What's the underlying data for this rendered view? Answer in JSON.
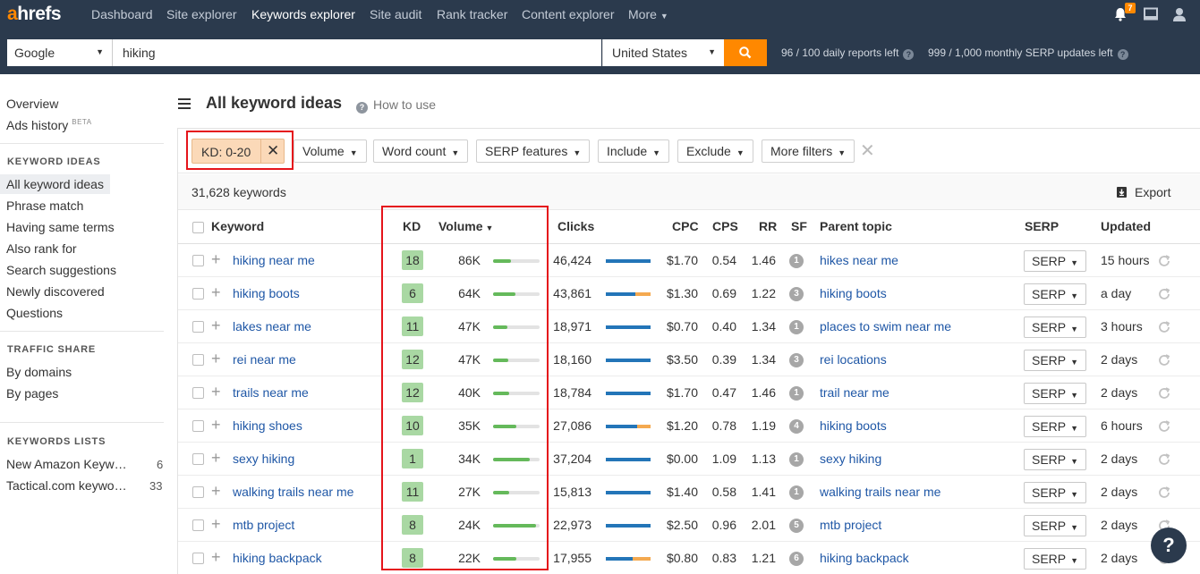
{
  "nav": {
    "logo_a": "a",
    "logo_rest": "hrefs",
    "items": [
      "Dashboard",
      "Site explorer",
      "Keywords explorer",
      "Site audit",
      "Rank tracker",
      "Content explorer",
      "More"
    ],
    "notifications_badge": "7"
  },
  "search": {
    "engine": "Google",
    "keyword": "hiking",
    "country": "United States",
    "daily_reports": "96 / 100 daily reports left",
    "monthly_updates": "999 / 1,000 monthly SERP updates left"
  },
  "sidebar": {
    "overview": "Overview",
    "ads_history": "Ads history",
    "beta": "BETA",
    "keyword_ideas_head": "KEYWORD IDEAS",
    "keyword_ideas": [
      "All keyword ideas",
      "Phrase match",
      "Having same terms",
      "Also rank for",
      "Search suggestions",
      "Newly discovered",
      "Questions"
    ],
    "traffic_share_head": "TRAFFIC SHARE",
    "traffic_share": [
      "By domains",
      "By pages"
    ],
    "keyword_lists_head": "KEYWORDS LISTS",
    "lists": [
      {
        "name": "New Amazon Keyw…",
        "count": "6"
      },
      {
        "name": "Tactical.com keywo…",
        "count": "33"
      }
    ]
  },
  "main": {
    "title": "All keyword ideas",
    "how_to_use": "How to use",
    "kd_filter": "KD: 0-20",
    "filters": [
      "Volume",
      "Word count",
      "SERP features",
      "Include",
      "Exclude",
      "More filters"
    ],
    "keyword_count": "31,628 keywords",
    "export": "Export"
  },
  "table": {
    "headers": {
      "keyword": "Keyword",
      "kd": "KD",
      "volume": "Volume",
      "clicks": "Clicks",
      "cpc": "CPC",
      "cps": "CPS",
      "rr": "RR",
      "sf": "SF",
      "parent": "Parent topic",
      "serp": "SERP",
      "updated": "Updated"
    },
    "serp_label": "SERP",
    "rows": [
      {
        "keyword": "hiking near me",
        "kd": "18",
        "volume": "86K",
        "clicks": "46,424",
        "cpc": "$1.70",
        "cps": "0.54",
        "rr": "1.46",
        "sf": "1",
        "parent": "hikes near me",
        "updated": "15 hours"
      },
      {
        "keyword": "hiking boots",
        "kd": "6",
        "volume": "64K",
        "clicks": "43,861",
        "cpc": "$1.30",
        "cps": "0.69",
        "rr": "1.22",
        "sf": "3",
        "parent": "hiking boots",
        "updated": "a day"
      },
      {
        "keyword": "lakes near me",
        "kd": "11",
        "volume": "47K",
        "clicks": "18,971",
        "cpc": "$0.70",
        "cps": "0.40",
        "rr": "1.34",
        "sf": "1",
        "parent": "places to swim near me",
        "updated": "3 hours"
      },
      {
        "keyword": "rei near me",
        "kd": "12",
        "volume": "47K",
        "clicks": "18,160",
        "cpc": "$3.50",
        "cps": "0.39",
        "rr": "1.34",
        "sf": "3",
        "parent": "rei locations",
        "updated": "2 days"
      },
      {
        "keyword": "trails near me",
        "kd": "12",
        "volume": "40K",
        "clicks": "18,784",
        "cpc": "$1.70",
        "cps": "0.47",
        "rr": "1.46",
        "sf": "1",
        "parent": "trail near me",
        "updated": "2 days"
      },
      {
        "keyword": "hiking shoes",
        "kd": "10",
        "volume": "35K",
        "clicks": "27,086",
        "cpc": "$1.20",
        "cps": "0.78",
        "rr": "1.19",
        "sf": "4",
        "parent": "hiking boots",
        "updated": "6 hours"
      },
      {
        "keyword": "sexy hiking",
        "kd": "1",
        "volume": "34K",
        "clicks": "37,204",
        "cpc": "$0.00",
        "cps": "1.09",
        "rr": "1.13",
        "sf": "1",
        "parent": "sexy hiking",
        "updated": "2 days"
      },
      {
        "keyword": "walking trails near me",
        "kd": "11",
        "volume": "27K",
        "clicks": "15,813",
        "cpc": "$1.40",
        "cps": "0.58",
        "rr": "1.41",
        "sf": "1",
        "parent": "walking trails near me",
        "updated": "2 days"
      },
      {
        "keyword": "mtb project",
        "kd": "8",
        "volume": "24K",
        "clicks": "22,973",
        "cpc": "$2.50",
        "cps": "0.96",
        "rr": "2.01",
        "sf": "5",
        "parent": "mtb project",
        "updated": "2 days"
      },
      {
        "keyword": "hiking backpack",
        "kd": "8",
        "volume": "22K",
        "clicks": "17,955",
        "cpc": "$0.80",
        "cps": "0.83",
        "rr": "1.21",
        "sf": "6",
        "parent": "hiking backpack",
        "updated": "2 days"
      }
    ],
    "volume_bar_fraction": [
      0.38,
      0.48,
      0.3,
      0.32,
      0.34,
      0.5,
      0.78,
      0.34,
      0.92,
      0.5
    ],
    "clicks_bar": [
      {
        "paid": 0.0
      },
      {
        "paid": 0.34
      },
      {
        "paid": 0.0
      },
      {
        "paid": 0.0
      },
      {
        "paid": 0.0
      },
      {
        "paid": 0.3
      },
      {
        "paid": 0.0
      },
      {
        "paid": 0.0
      },
      {
        "paid": 0.0
      },
      {
        "paid": 0.4
      }
    ]
  },
  "help": "?",
  "colors": {
    "nav_bg": "#2b3a4d",
    "accent": "#ff8800",
    "link": "#1f57a6",
    "kd_green": "#a9d8a3",
    "highlight": "#e5141b"
  }
}
